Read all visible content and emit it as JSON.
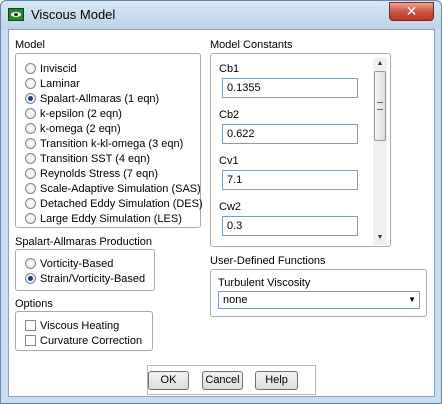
{
  "window": {
    "title": "Viscous Model",
    "close_glyph": "✕"
  },
  "model": {
    "label": "Model",
    "options": [
      {
        "label": "Inviscid",
        "selected": false
      },
      {
        "label": "Laminar",
        "selected": false
      },
      {
        "label": "Spalart-Allmaras (1 eqn)",
        "selected": true
      },
      {
        "label": "k-epsilon (2 eqn)",
        "selected": false
      },
      {
        "label": "k-omega (2 eqn)",
        "selected": false
      },
      {
        "label": "Transition k-kl-omega (3 eqn)",
        "selected": false
      },
      {
        "label": "Transition SST (4 eqn)",
        "selected": false
      },
      {
        "label": "Reynolds Stress (7 eqn)",
        "selected": false
      },
      {
        "label": "Scale-Adaptive Simulation (SAS)",
        "selected": false
      },
      {
        "label": "Detached Eddy Simulation (DES)",
        "selected": false
      },
      {
        "label": "Large Eddy Simulation (LES)",
        "selected": false
      }
    ]
  },
  "production": {
    "label": "Spalart-Allmaras Production",
    "options": [
      {
        "label": "Vorticity-Based",
        "selected": false
      },
      {
        "label": "Strain/Vorticity-Based",
        "selected": true
      }
    ]
  },
  "options": {
    "label": "Options",
    "items": [
      {
        "label": "Viscous Heating",
        "checked": false
      },
      {
        "label": "Curvature Correction",
        "checked": false
      }
    ]
  },
  "constants": {
    "label": "Model Constants",
    "fields": [
      {
        "label": "Cb1",
        "value": "0.1355"
      },
      {
        "label": "Cb2",
        "value": "0.622"
      },
      {
        "label": "Cv1",
        "value": "7.1"
      },
      {
        "label": "Cw2",
        "value": "0.3"
      }
    ],
    "scroll_up": "▲",
    "scroll_down": "▼"
  },
  "udf": {
    "label": "User-Defined Functions",
    "viscosity_label": "Turbulent Viscosity",
    "viscosity_value": "none",
    "dropdown_glyph": "▼"
  },
  "buttons": {
    "ok": "OK",
    "cancel": "Cancel",
    "help": "Help"
  }
}
